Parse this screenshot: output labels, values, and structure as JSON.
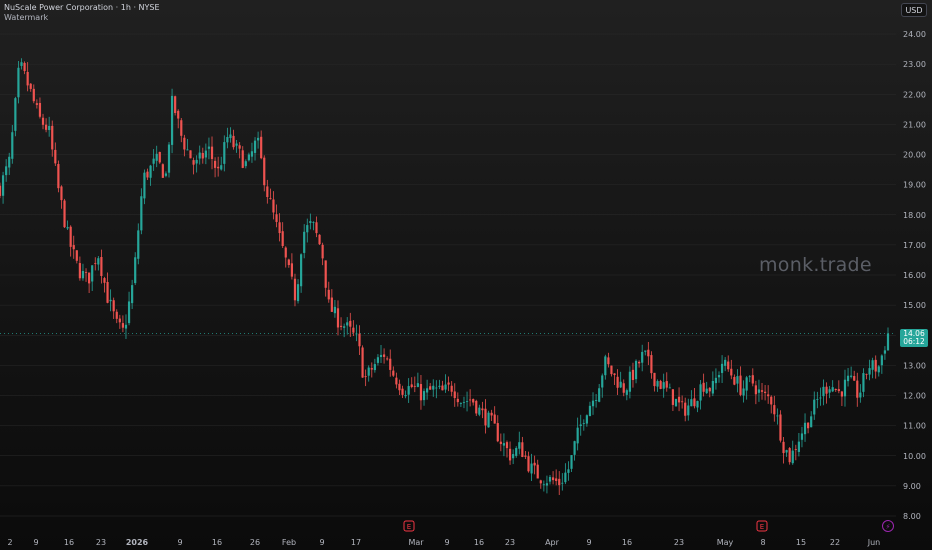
{
  "header": {
    "title": "NuScale Power Corporation · 1h · NYSE",
    "subtitle": "Watermark"
  },
  "currency": "USD",
  "watermark": "monk.trade",
  "last_price": {
    "value": "14.06",
    "countdown": "06:12"
  },
  "colors": {
    "up": "#26a69a",
    "down": "#ef5350",
    "grid": "#2a2a2a",
    "axis_text": "#b2b5be",
    "event_marker": "#f23645",
    "dividend_marker": "#9c27b0"
  },
  "chart_data": {
    "type": "candlestick",
    "timeframe": "1h",
    "ylim": [
      8.0,
      24.0
    ],
    "y_ticks": [
      "24.00",
      "23.00",
      "22.00",
      "21.00",
      "20.00",
      "19.00",
      "18.00",
      "17.00",
      "16.00",
      "15.00",
      "14.00",
      "13.00",
      "12.00",
      "11.00",
      "10.00",
      "9.00",
      "8.00"
    ],
    "x_tick_labels": [
      "2",
      "9",
      "16",
      "23",
      "2026",
      "9",
      "16",
      "26",
      "Feb",
      "9",
      "17",
      "Mar",
      "9",
      "16",
      "23",
      "Apr",
      "9",
      "16",
      "23",
      "May",
      "8",
      "15",
      "22",
      "Jun"
    ],
    "price_path_anchors": [
      {
        "t": 0,
        "p": 18.9
      },
      {
        "t": 3,
        "p": 19.8
      },
      {
        "t": 6,
        "p": 23.0
      },
      {
        "t": 9,
        "p": 22.2
      },
      {
        "t": 12,
        "p": 21.2
      },
      {
        "t": 15,
        "p": 20.8
      },
      {
        "t": 18,
        "p": 18.8
      },
      {
        "t": 21,
        "p": 17.2
      },
      {
        "t": 24,
        "p": 16.2
      },
      {
        "t": 27,
        "p": 15.8
      },
      {
        "t": 30,
        "p": 16.8
      },
      {
        "t": 33,
        "p": 15.3
      },
      {
        "t": 36,
        "p": 14.3
      },
      {
        "t": 38,
        "p": 14.1
      },
      {
        "t": 41,
        "p": 15.8
      },
      {
        "t": 44,
        "p": 19.2
      },
      {
        "t": 48,
        "p": 19.8
      },
      {
        "t": 51,
        "p": 19.3
      },
      {
        "t": 53,
        "p": 21.8
      },
      {
        "t": 56,
        "p": 20.5
      },
      {
        "t": 60,
        "p": 19.6
      },
      {
        "t": 64,
        "p": 20.2
      },
      {
        "t": 67,
        "p": 19.4
      },
      {
        "t": 70,
        "p": 20.6
      },
      {
        "t": 73,
        "p": 20.1
      },
      {
        "t": 76,
        "p": 19.6
      },
      {
        "t": 79,
        "p": 20.5
      },
      {
        "t": 82,
        "p": 18.8
      },
      {
        "t": 85,
        "p": 17.6
      },
      {
        "t": 88,
        "p": 16.4
      },
      {
        "t": 91,
        "p": 15.2
      },
      {
        "t": 93,
        "p": 17.4
      },
      {
        "t": 96,
        "p": 17.7
      },
      {
        "t": 99,
        "p": 16.8
      },
      {
        "t": 101,
        "p": 15.0
      },
      {
        "t": 104,
        "p": 14.5
      },
      {
        "t": 107,
        "p": 14.2
      },
      {
        "t": 110,
        "p": 13.8
      },
      {
        "t": 112,
        "p": 12.5
      },
      {
        "t": 115,
        "p": 13.0
      },
      {
        "t": 118,
        "p": 13.4
      },
      {
        "t": 121,
        "p": 12.7
      },
      {
        "t": 124,
        "p": 12.2
      },
      {
        "t": 127,
        "p": 12.3
      },
      {
        "t": 130,
        "p": 12.0
      },
      {
        "t": 133,
        "p": 12.2
      },
      {
        "t": 136,
        "p": 12.1
      },
      {
        "t": 139,
        "p": 12.3
      },
      {
        "t": 142,
        "p": 11.8
      },
      {
        "t": 145,
        "p": 11.9
      },
      {
        "t": 148,
        "p": 11.4
      },
      {
        "t": 151,
        "p": 11.1
      },
      {
        "t": 154,
        "p": 10.5
      },
      {
        "t": 157,
        "p": 10.0
      },
      {
        "t": 160,
        "p": 10.3
      },
      {
        "t": 163,
        "p": 9.6
      },
      {
        "t": 166,
        "p": 9.3
      },
      {
        "t": 169,
        "p": 9.2
      },
      {
        "t": 172,
        "p": 9.1
      },
      {
        "t": 175,
        "p": 9.6
      },
      {
        "t": 177,
        "p": 10.5
      },
      {
        "t": 180,
        "p": 11.5
      },
      {
        "t": 183,
        "p": 12.0
      },
      {
        "t": 186,
        "p": 13.1
      },
      {
        "t": 189,
        "p": 12.6
      },
      {
        "t": 192,
        "p": 12.2
      },
      {
        "t": 195,
        "p": 12.8
      },
      {
        "t": 198,
        "p": 13.4
      },
      {
        "t": 201,
        "p": 12.6
      },
      {
        "t": 204,
        "p": 12.3
      },
      {
        "t": 207,
        "p": 11.9
      },
      {
        "t": 210,
        "p": 11.5
      },
      {
        "t": 213,
        "p": 11.8
      },
      {
        "t": 216,
        "p": 12.4
      },
      {
        "t": 219,
        "p": 12.2
      },
      {
        "t": 222,
        "p": 13.1
      },
      {
        "t": 225,
        "p": 12.7
      },
      {
        "t": 228,
        "p": 12.2
      },
      {
        "t": 231,
        "p": 12.5
      },
      {
        "t": 234,
        "p": 12.0
      },
      {
        "t": 237,
        "p": 11.9
      },
      {
        "t": 239,
        "p": 11.2
      },
      {
        "t": 241,
        "p": 10.3
      },
      {
        "t": 243,
        "p": 9.9
      },
      {
        "t": 246,
        "p": 10.7
      },
      {
        "t": 249,
        "p": 11.3
      },
      {
        "t": 252,
        "p": 12.0
      },
      {
        "t": 255,
        "p": 12.4
      },
      {
        "t": 258,
        "p": 12.1
      },
      {
        "t": 261,
        "p": 12.5
      },
      {
        "t": 264,
        "p": 12.0
      },
      {
        "t": 267,
        "p": 13.0
      },
      {
        "t": 270,
        "p": 12.9
      },
      {
        "t": 273,
        "p": 14.06
      }
    ],
    "last_value": 14.06,
    "event_markers": [
      {
        "type": "earnings",
        "label": "E",
        "near_tick": "Mar"
      },
      {
        "type": "earnings",
        "label": "E",
        "near_tick": "8"
      },
      {
        "type": "dividend",
        "label": "⚡",
        "near_tick": "Jun"
      }
    ]
  }
}
